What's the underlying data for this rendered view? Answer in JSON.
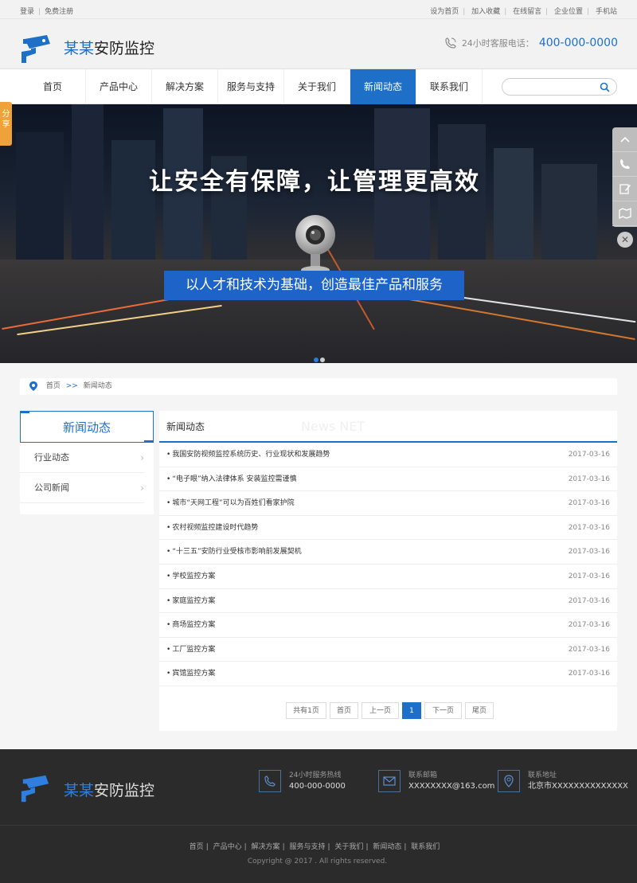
{
  "topbar": {
    "login": "登录",
    "register": "免费注册",
    "links": [
      "设为首页",
      "加入收藏",
      "在线留言",
      "企业位置",
      "手机站"
    ]
  },
  "header": {
    "brand_part1": "某某",
    "brand_part2": "安防监控",
    "hotline_label": "24小时客服电话：",
    "hotline_number": "400-000-0000"
  },
  "nav": {
    "items": [
      "首页",
      "产品中心",
      "解决方案",
      "服务与支持",
      "关于我们",
      "新闻动态",
      "联系我们"
    ],
    "active_index": 5,
    "search_placeholder": ""
  },
  "banner": {
    "headline": "让安全有保障，让管理更高效",
    "slogan": "以人才和技术为基础，创造最佳产品和服务",
    "slides": 2,
    "current_slide": 1
  },
  "share_label": "分享",
  "breadcrumb": {
    "home": "首页",
    "arrow": ">>",
    "current": "新闻动态"
  },
  "sidebar": {
    "title": "新闻动态",
    "items": [
      "行业动态",
      "公司新闻"
    ]
  },
  "main": {
    "title": "新闻动态",
    "ghost_title": "News NET",
    "news": [
      {
        "title": "我国安防视频监控系统历史、行业现状和发展趋势",
        "date": "2017-03-16"
      },
      {
        "title": "“电子眼”纳入法律体系 安装监控需谨慎",
        "date": "2017-03-16"
      },
      {
        "title": "城市“天网工程”可以为百姓们看家护院",
        "date": "2017-03-16"
      },
      {
        "title": "农村视频监控建设时代趋势",
        "date": "2017-03-16"
      },
      {
        "title": "“十三五”安防行业受核市影响前发展契机",
        "date": "2017-03-16"
      },
      {
        "title": "学校监控方案",
        "date": "2017-03-16"
      },
      {
        "title": "家庭监控方案",
        "date": "2017-03-16"
      },
      {
        "title": "商场监控方案",
        "date": "2017-03-16"
      },
      {
        "title": "工厂监控方案",
        "date": "2017-03-16"
      },
      {
        "title": "宾馆监控方案",
        "date": "2017-03-16"
      }
    ],
    "pager": {
      "total": "共有1页",
      "first": "首页",
      "prev": "上一页",
      "current": "1",
      "next": "下一页",
      "last": "尾页"
    }
  },
  "footer": {
    "brand_part1": "某某",
    "brand_part2": "安防监控",
    "contacts": [
      {
        "label": "24小时服务热线",
        "value": "400-000-0000",
        "icon": "phone-icon"
      },
      {
        "label": "联系邮箱",
        "value": "XXXXXXXX@163.com",
        "icon": "mail-icon"
      },
      {
        "label": "联系地址",
        "value": "北京市XXXXXXXXXXXXXX",
        "icon": "location-icon"
      }
    ],
    "links": [
      "首页",
      "产品中心",
      "解决方案",
      "服务与支持",
      "关于我们",
      "新闻动态",
      "联系我们"
    ],
    "copyright": "Copyright @ 2017 . All rights reserved."
  },
  "colors": {
    "accent": "#1e6fc8",
    "share": "#f0a23a",
    "footer_bg": "#2b2b2b"
  }
}
